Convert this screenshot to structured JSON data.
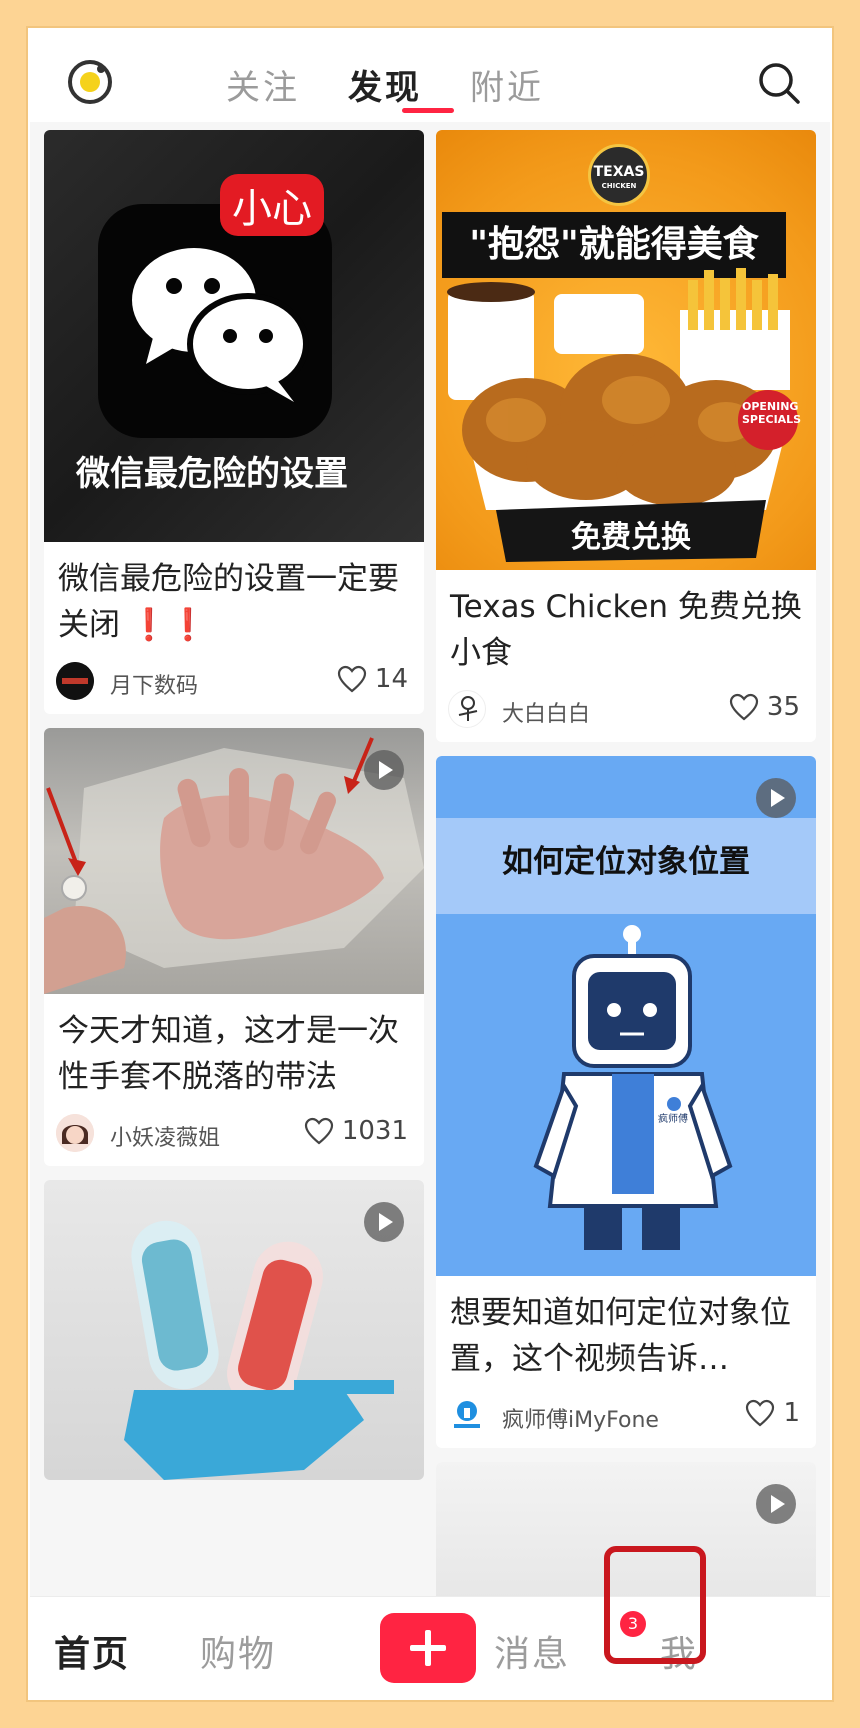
{
  "top_tabs": [
    {
      "label": "关注"
    },
    {
      "label": "发现"
    },
    {
      "label": "附近"
    }
  ],
  "feed": {
    "left": [
      {
        "image_caption": "微信最危险的设置",
        "image_tag": "小心",
        "title": "微信最危险的设置一定要关闭 ❗❗",
        "author": "月下数码",
        "avatar_text": "月下数码",
        "likes": "14"
      },
      {
        "title": "今天才知道，这才是一次性手套不脱落的带法",
        "author": "小妖凌薇姐",
        "likes": "1031"
      },
      {
        "title": ""
      }
    ],
    "right": [
      {
        "image_headline": "\"抱怨\"就能得美食",
        "image_badge": "TEXAS",
        "image_badge_sub": "CHICKEN",
        "image_tag": "免费兑换",
        "image_sticker": "OPENING SPECIALS",
        "title": "Texas Chicken 免费兑换小食",
        "author": "大白白白",
        "likes": "35"
      },
      {
        "image_headline": "如何定位对象位置",
        "robot_badge": "疯师傅",
        "title": "想要知道如何定位对象位置，这个视频告诉…",
        "author": "疯师傅iMyFone",
        "likes": "1"
      }
    ]
  },
  "bottom_nav": {
    "home": "首页",
    "shop": "购物",
    "messages": "消息",
    "messages_badge": "3",
    "me": "我"
  },
  "colors": {
    "accent": "#ff2442",
    "page_bg": "#fdd494",
    "highlight_box": "#c9171e"
  }
}
